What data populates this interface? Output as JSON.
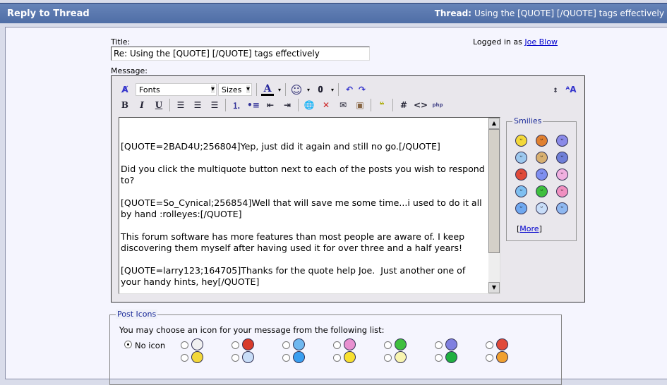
{
  "header": {
    "title": "Reply to Thread",
    "thread_label": "Thread:",
    "thread_title": "Using the [QUOTE] [/QUOTE] tags effectively"
  },
  "form": {
    "title_label": "Title:",
    "title_value": "Re: Using the [QUOTE] [/QUOTE] tags effectively",
    "logged_in_text": "Logged in as",
    "user": "Joe Blow",
    "message_label": "Message:"
  },
  "toolbar": {
    "fonts": "Fonts",
    "sizes": "Sizes"
  },
  "message": "[QUOTE=2BAD4U;256804]Yep, just did it again and still no go.[/QUOTE]\n\nDid you click the multiquote button next to each of the posts you wish to respond to?\n\n[QUOTE=So_Cynical;256854]Well that will save me some time...i used to do it all by hand :rolleyes:[/QUOTE]\n\nThis forum software has more features than most people are aware of. I keep discovering them myself after having used it for over three and a half years!\n\n[QUOTE=larry123;164705]Thanks for the quote help Joe.  Just another one of your handy hints, hey[/QUOTE]\n\nAlways happy to help Larry... glad you found this thread useful! :)",
  "smilies": {
    "title": "Smilies",
    "more": "More",
    "items": [
      {
        "name": "smile",
        "color": "#f3d83a"
      },
      {
        "name": "banghead",
        "color": "#e08030"
      },
      {
        "name": "frown",
        "color": "#8a8ae8"
      },
      {
        "name": "confused",
        "color": "#9cc8ee"
      },
      {
        "name": "coin",
        "color": "#d8b070"
      },
      {
        "name": "rolleyes",
        "color": "#6f7fd8"
      },
      {
        "name": "mad",
        "color": "#e04a3a"
      },
      {
        "name": "cool-band",
        "color": "#7f8ff0"
      },
      {
        "name": "tongue",
        "color": "#f0b0e0"
      },
      {
        "name": "wink",
        "color": "#7fbff0"
      },
      {
        "name": "biggrin",
        "color": "#3fbf3f"
      },
      {
        "name": "redface",
        "color": "#f090c0"
      },
      {
        "name": "smile-blue",
        "color": "#6fa8f0"
      },
      {
        "name": "cool",
        "color": "#c8ddf8"
      },
      {
        "name": "eek",
        "color": "#8fb8f0"
      }
    ]
  },
  "post_icons": {
    "title": "Post Icons",
    "instructions": "You may choose an icon for your message from the following list:",
    "no_icon": "No icon",
    "selected": "No icon",
    "items": [
      {
        "name": "post",
        "color": "#f0f0f0"
      },
      {
        "name": "thumbs-down",
        "color": "#d83a2a"
      },
      {
        "name": "wink",
        "color": "#6fb8f0"
      },
      {
        "name": "tongue",
        "color": "#e890d0"
      },
      {
        "name": "biggrin",
        "color": "#3fbf3f"
      },
      {
        "name": "frown",
        "color": "#8080e0"
      },
      {
        "name": "mad",
        "color": "#e04a3a"
      },
      {
        "name": "smile",
        "color": "#f3d83a"
      },
      {
        "name": "cool",
        "color": "#c8ddf8"
      },
      {
        "name": "question",
        "color": "#3a9ff0"
      },
      {
        "name": "exclamation",
        "color": "#f8e030"
      },
      {
        "name": "lightbulb",
        "color": "#f8f4b0"
      },
      {
        "name": "arrow",
        "color": "#20b040"
      },
      {
        "name": "thumbs-up",
        "color": "#f0a030"
      }
    ]
  }
}
